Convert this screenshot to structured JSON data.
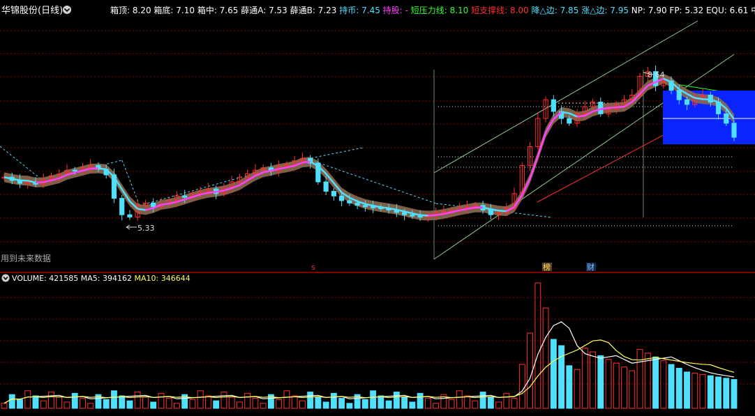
{
  "title": "华锦股份(日线)",
  "params": [
    {
      "label": "箱顶: ",
      "value": "8.20",
      "color": "#ffffff"
    },
    {
      "label": "箱底: ",
      "value": "7.10",
      "color": "#ffffff"
    },
    {
      "label": "箱中: ",
      "value": "7.65",
      "color": "#ffffff"
    },
    {
      "label": "薛通A: ",
      "value": "7.53",
      "color": "#ffffff"
    },
    {
      "label": "薛通B: ",
      "value": "7.23",
      "color": "#ffffff"
    },
    {
      "label": "持币: ",
      "value": "7.45",
      "color": "#4fe0ff"
    },
    {
      "label": "持股: ",
      "value": "-",
      "color": "#ff40ff"
    },
    {
      "label": "短压力线: ",
      "value": "8.10",
      "color": "#33ff33"
    },
    {
      "label": "短支撑线: ",
      "value": "8.00",
      "color": "#ff3030"
    },
    {
      "label": "降△边: ",
      "value": "7.85",
      "color": "#4fe0ff"
    },
    {
      "label": "涨△边: ",
      "value": "7.95",
      "color": "#4fe0ff"
    },
    {
      "label": "NP: ",
      "value": "7.90",
      "color": "#ffffff"
    },
    {
      "label": "FP: ",
      "value": "5.32",
      "color": "#ffffff"
    },
    {
      "label": "EQU: ",
      "value": "6.61",
      "color": "#ffffff"
    },
    {
      "label": "中◇",
      "value": "",
      "color": "#ffffff"
    }
  ],
  "annotations": {
    "high_label": "8.64",
    "low_label": "5.33",
    "future_data": "用到未来数据",
    "marker_s": "s",
    "marker_bang": "榜",
    "marker_cai": "财"
  },
  "volume_panel": {
    "label": "VOLUME: 421585",
    "ma5": "MA5: 394162",
    "ma10": "MA10: 346644",
    "ma5_color": "#ffffff",
    "ma10_color": "#ffff55"
  },
  "colors": {
    "up": "#ff3030",
    "down": "#4fe0ff",
    "grid": "#8b0000",
    "band": "#8b6a4f",
    "ma_up": "#ff40ff",
    "ma_down": "#4fe0ff",
    "box": "#0a24ff"
  },
  "chart_data": {
    "type": "candlestick",
    "series": "close_trajectory",
    "values": [
      6.35,
      6.28,
      6.22,
      6.25,
      6.2,
      6.3,
      6.38,
      6.42,
      6.5,
      6.48,
      6.55,
      6.6,
      6.52,
      6.4,
      5.9,
      5.55,
      5.5,
      5.75,
      5.8,
      5.72,
      5.78,
      5.85,
      5.95,
      5.92,
      6.0,
      6.05,
      6.1,
      6.0,
      6.12,
      6.25,
      6.35,
      6.42,
      6.5,
      6.55,
      6.48,
      6.58,
      6.62,
      6.7,
      6.75,
      6.65,
      6.25,
      6.05,
      5.95,
      5.85,
      5.8,
      5.75,
      5.72,
      5.7,
      5.68,
      5.65,
      5.6,
      5.55,
      5.52,
      5.5,
      5.55,
      5.6,
      5.62,
      5.65,
      5.7,
      5.72,
      5.75,
      5.65,
      5.55,
      5.6,
      5.7,
      6.0,
      6.6,
      7.0,
      7.6,
      8.0,
      7.75,
      7.6,
      7.5,
      7.7,
      7.85,
      7.95,
      7.7,
      7.8,
      7.9,
      8.0,
      8.1,
      8.5,
      8.6,
      8.3,
      8.4,
      8.2,
      8.0,
      7.9,
      8.05,
      8.1,
      7.95,
      7.7,
      7.5,
      7.2
    ],
    "annotated_high": 8.64,
    "annotated_low": 5.33,
    "volume": {
      "last": 421585,
      "ma5": 394162,
      "ma10": 346644
    }
  }
}
